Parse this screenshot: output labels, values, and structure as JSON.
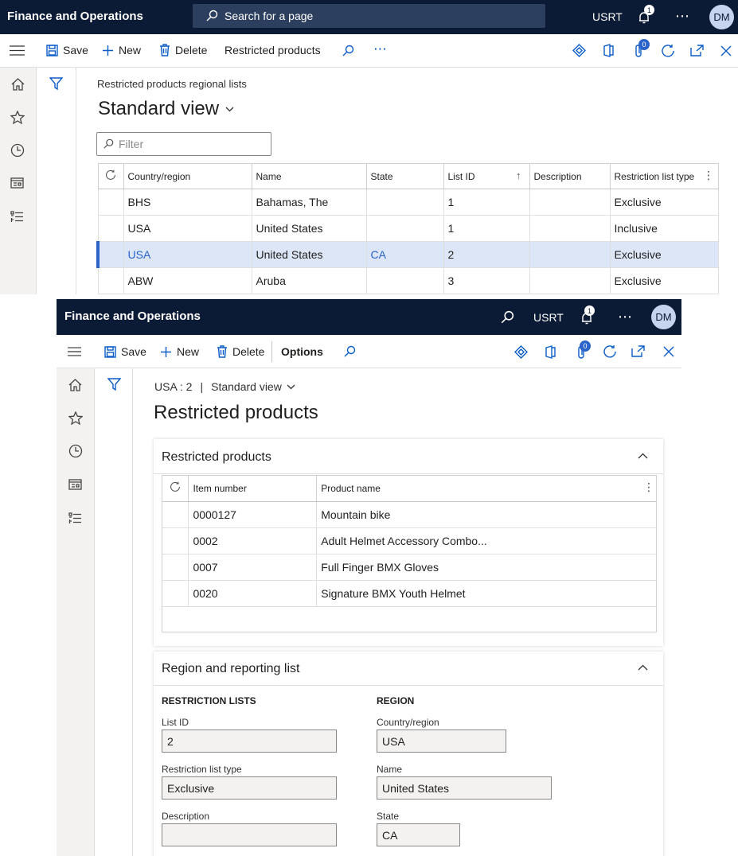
{
  "top": {
    "app_title": "Finance and Operations",
    "search_text": "Search for a page",
    "company": "USRT",
    "notif_count": "1",
    "more": "⋯",
    "avatar": "DM",
    "toolbar": {
      "save": "Save",
      "new": "New",
      "delete": "Delete",
      "restricted_products": "Restricted products",
      "more": "⋯",
      "attach_count": "0"
    },
    "breadcrumb": "Restricted products regional lists",
    "view_title": "Standard view",
    "filter_placeholder": "Filter",
    "grid": {
      "headers": [
        "Country/region",
        "Name",
        "State",
        "List ID",
        "Description",
        "Restriction list type"
      ],
      "sort_glyph": "↑",
      "rows": [
        [
          "BHS",
          "Bahamas, The",
          "",
          "1",
          "",
          "Exclusive"
        ],
        [
          "USA",
          "United States",
          "",
          "1",
          "",
          "Inclusive"
        ],
        [
          "USA",
          "United States",
          "CA",
          "2",
          "",
          "Exclusive"
        ],
        [
          "ABW",
          "Aruba",
          "",
          "3",
          "",
          "Exclusive"
        ]
      ]
    }
  },
  "bottom": {
    "app_title": "Finance and Operations",
    "company": "USRT",
    "notif_count": "1",
    "more": "⋯",
    "avatar": "DM",
    "toolbar": {
      "save": "Save",
      "new": "New",
      "delete": "Delete",
      "options": "Options",
      "attach_count": "0"
    },
    "breadcrumb_record": "USA : 2",
    "breadcrumb_sep": "|",
    "breadcrumb_view": "Standard view",
    "page_title": "Restricted products",
    "products_section": {
      "title": "Restricted products",
      "headers": [
        "Item number",
        "Product name"
      ],
      "rows": [
        [
          "0000127",
          "Mountain bike"
        ],
        [
          "0002",
          "Adult Helmet Accessory Combo..."
        ],
        [
          "0007",
          "Full Finger BMX Gloves"
        ],
        [
          "0020",
          "Signature BMX Youth Helmet"
        ]
      ]
    },
    "region_section": {
      "title": "Region and reporting list",
      "restriction_lists_head": "RESTRICTION LISTS",
      "region_head": "REGION",
      "list_id_label": "List ID",
      "list_id_value": "2",
      "list_type_label": "Restriction list type",
      "list_type_value": "Exclusive",
      "description_label": "Description",
      "description_value": "",
      "country_label": "Country/region",
      "country_value": "USA",
      "name_label": "Name",
      "name_value": "United States",
      "state_label": "State",
      "state_value": "CA"
    }
  },
  "colors": {
    "topbar": "#0b1a35",
    "accent": "#2b63c8",
    "selected_row": "#dce6f7"
  }
}
